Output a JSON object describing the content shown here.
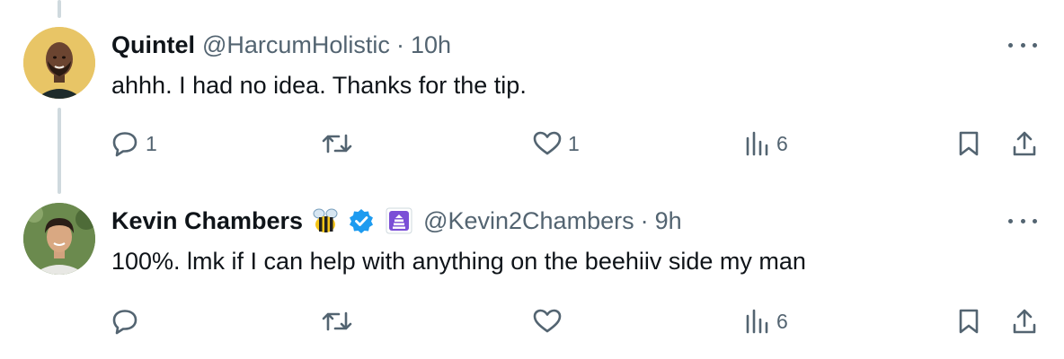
{
  "thread": [
    {
      "name": "Quintel",
      "handle": "@HarcumHolistic",
      "separator": "·",
      "time": "10h",
      "text": "ahhh. I had no idea. Thanks for the tip.",
      "stats": {
        "replies": "1",
        "retweets": "",
        "likes": "1",
        "views": "6"
      },
      "avatar_bg": "#e8c566"
    },
    {
      "name": "Kevin Chambers",
      "handle": "@Kevin2Chambers",
      "separator": "·",
      "time": "9h",
      "text": "100%. lmk if I can help with anything on the beehiiv side my man",
      "stats": {
        "replies": "",
        "retweets": "",
        "likes": "",
        "views": "6"
      },
      "badges": [
        "bee-emoji-icon",
        "verified-badge-icon",
        "affiliate-badge-icon"
      ],
      "avatar_bg": "#6b8a4e"
    }
  ],
  "colors": {
    "text": "#0f1419",
    "secondary": "#536471",
    "thread_line": "#cfd9de",
    "verified": "#1d9bf0",
    "affiliate": "#7b4fd6"
  }
}
